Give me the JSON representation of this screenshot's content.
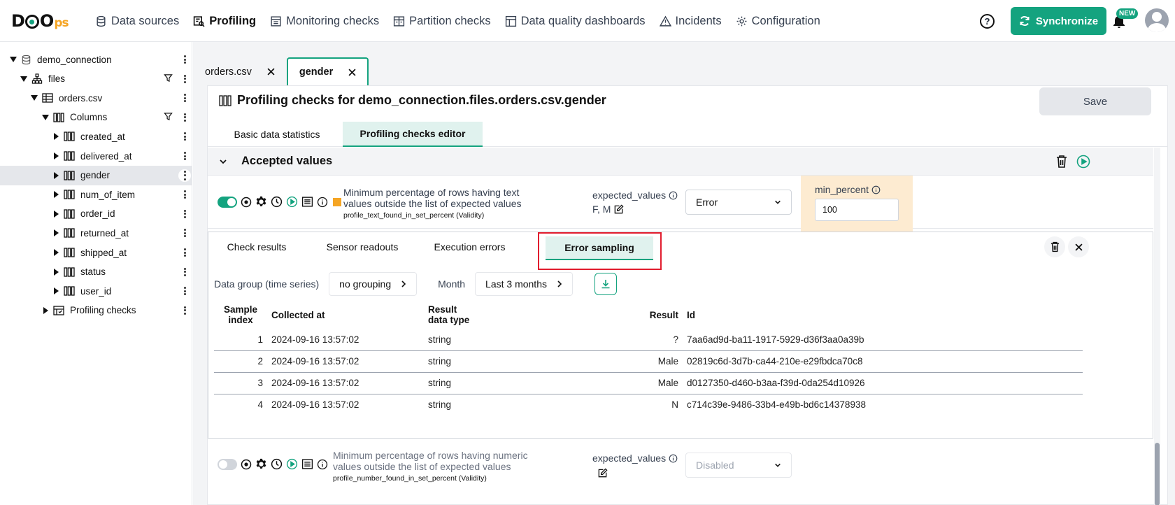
{
  "brand": {
    "logo_main": "DQO",
    "logo_suffix": "ps",
    "accent": "#14a37f",
    "highlight": "#e11d2e"
  },
  "nav": [
    {
      "label": "Data sources",
      "icon": "database-icon"
    },
    {
      "label": "Profiling",
      "icon": "profiling-icon",
      "active": true
    },
    {
      "label": "Monitoring checks",
      "icon": "calendar-check-icon"
    },
    {
      "label": "Partition checks",
      "icon": "partition-icon"
    },
    {
      "label": "Data quality dashboards",
      "icon": "dashboard-icon"
    },
    {
      "label": "Incidents",
      "icon": "warning-icon"
    },
    {
      "label": "Configuration",
      "icon": "gear-icon"
    }
  ],
  "header": {
    "help": "?",
    "sync_label": "Synchronize",
    "new_badge": "NEW"
  },
  "tree": [
    {
      "label": "demo_connection",
      "level": 0,
      "icon": "database-icon",
      "caret": "down"
    },
    {
      "label": "files",
      "level": 1,
      "icon": "schema-icon",
      "caret": "down",
      "filter": true
    },
    {
      "label": "orders.csv",
      "level": 2,
      "icon": "table-icon",
      "caret": "down"
    },
    {
      "label": "Columns",
      "level": 3,
      "icon": "columns-icon",
      "caret": "down",
      "filter": true
    },
    {
      "label": "created_at",
      "level": 4,
      "icon": "column-icon",
      "caret": "right"
    },
    {
      "label": "delivered_at",
      "level": 4,
      "icon": "column-icon",
      "caret": "right"
    },
    {
      "label": "gender",
      "level": 4,
      "icon": "column-icon",
      "caret": "right",
      "selected": true
    },
    {
      "label": "num_of_item",
      "level": 4,
      "icon": "column-icon",
      "caret": "right"
    },
    {
      "label": "order_id",
      "level": 4,
      "icon": "column-icon",
      "caret": "right"
    },
    {
      "label": "returned_at",
      "level": 4,
      "icon": "column-icon",
      "caret": "right"
    },
    {
      "label": "shipped_at",
      "level": 4,
      "icon": "column-icon",
      "caret": "right"
    },
    {
      "label": "status",
      "level": 4,
      "icon": "column-icon",
      "caret": "right"
    },
    {
      "label": "user_id",
      "level": 4,
      "icon": "column-icon",
      "caret": "right"
    },
    {
      "label": "Profiling checks",
      "level": 3,
      "icon": "checks-table-icon",
      "caret": "right"
    }
  ],
  "file_tabs": [
    {
      "label": "orders.csv",
      "active": false
    },
    {
      "label": "gender",
      "active": true
    }
  ],
  "panel": {
    "title": "Profiling checks for demo_connection.files.orders.csv.gender",
    "save_label": "Save",
    "subtabs": [
      {
        "label": "Basic data statistics",
        "active": false
      },
      {
        "label": "Profiling checks editor",
        "active": true
      }
    ]
  },
  "category": {
    "title": "Accepted values"
  },
  "checks": [
    {
      "enabled": true,
      "description": "Minimum percentage of rows having text values outside the list of expected values",
      "name": "profile_text_found_in_set_percent",
      "dimension": "(Validity)",
      "param_label": "expected_values",
      "param_value": "F, M",
      "severity": "Error",
      "rule_label": "min_percent",
      "rule_value": "100"
    },
    {
      "enabled": false,
      "description": "Minimum percentage of rows having numeric values outside the list of expected values",
      "name": "profile_number_found_in_set_percent",
      "dimension": "(Validity)",
      "param_label": "expected_values",
      "severity": "Disabled"
    }
  ],
  "details": {
    "tabs": [
      {
        "label": "Check results",
        "active": false
      },
      {
        "label": "Sensor readouts",
        "active": false
      },
      {
        "label": "Execution errors",
        "active": false
      },
      {
        "label": "Error sampling",
        "active": true
      }
    ],
    "data_group_label": "Data group (time series)",
    "data_group_value": "no grouping",
    "month_label": "Month",
    "month_value": "Last 3 months",
    "columns": [
      "Sample index",
      "Collected at",
      "Result data type",
      "Result",
      "Id"
    ],
    "rows": [
      {
        "index": "1",
        "collected_at": "2024-09-16 13:57:02",
        "type": "string",
        "result": "?",
        "id": "7aa6ad9d-ba11-1917-5929-d36f3aa0a39b"
      },
      {
        "index": "2",
        "collected_at": "2024-09-16 13:57:02",
        "type": "string",
        "result": "Male",
        "id": "02819c6d-3d7b-ca44-210e-e29fbdca70c8"
      },
      {
        "index": "3",
        "collected_at": "2024-09-16 13:57:02",
        "type": "string",
        "result": "Male",
        "id": "d0127350-d460-b3aa-f39d-0da254d10926"
      },
      {
        "index": "4",
        "collected_at": "2024-09-16 13:57:02",
        "type": "string",
        "result": "N",
        "id": "c714c39e-9486-33b4-e49b-bd6c14378938"
      }
    ]
  }
}
